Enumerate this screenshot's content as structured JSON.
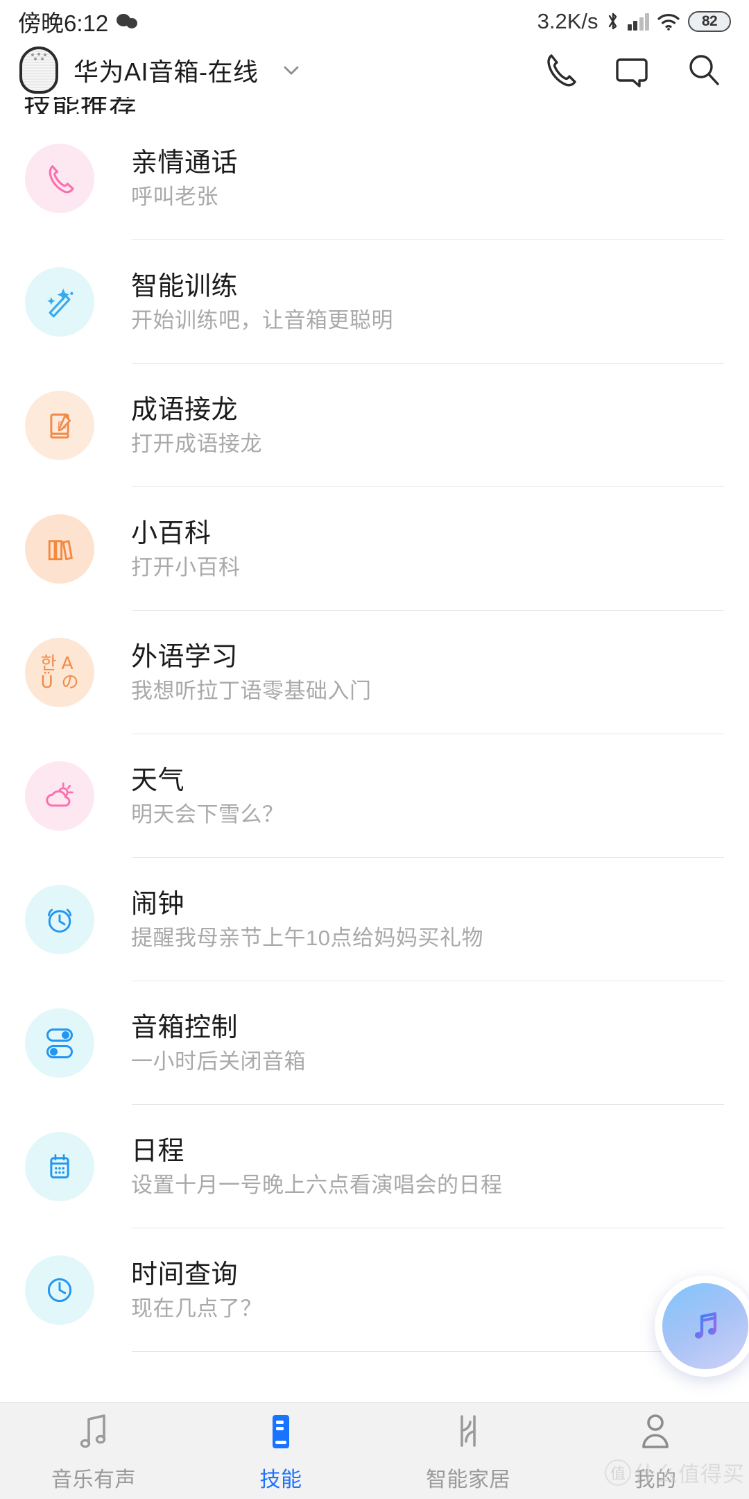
{
  "status_bar": {
    "time": "傍晚6:12",
    "wechat_icon": "wechat-bubbles-icon",
    "network_speed": "3.2K/s",
    "bluetooth_icon": "bluetooth-icon",
    "signal_icon": "cellular-signal-icon",
    "wifi_icon": "wifi-icon",
    "battery_level": "82"
  },
  "header": {
    "device_icon": "smart-speaker-icon",
    "device_name": "华为AI音箱-在线",
    "dropdown_icon": "chevron-down-icon",
    "actions": [
      {
        "name": "call-icon",
        "label": "phone-call"
      },
      {
        "name": "message-icon",
        "label": "chat-message"
      },
      {
        "name": "search-icon",
        "label": "search"
      }
    ]
  },
  "section": {
    "title": "技能推荐"
  },
  "skills": [
    {
      "title": "亲情通话",
      "subtitle": "呼叫老张",
      "icon": "phone-call-icon",
      "bg": "#fde7f1",
      "fg": "#fb6fae"
    },
    {
      "title": "智能训练",
      "subtitle": "开始训练吧，让音箱更聪明",
      "icon": "magic-wand-sparkle-icon",
      "bg": "#e2f7f9",
      "fg": "#36a9f0"
    },
    {
      "title": "成语接龙",
      "subtitle": "打开成语接龙",
      "icon": "idiom-book-pencil-icon",
      "bg": "#fdeadb",
      "fg": "#f08a4b"
    },
    {
      "title": "小百科",
      "subtitle": "打开小百科",
      "icon": "books-icon",
      "bg": "#fde2cf",
      "fg": "#f4883f"
    },
    {
      "title": "外语学习",
      "subtitle": "我想听拉丁语零基础入门",
      "icon": "language-characters-icon",
      "bg": "#fde6d3",
      "fg": "#f08a4b",
      "glyphs": [
        "한",
        "A",
        "Ü",
        "の"
      ]
    },
    {
      "title": "天气",
      "subtitle": "明天会下雪么？",
      "icon": "sun-cloud-weather-icon",
      "bg": "#fde7f1",
      "fg": "#fb6fae"
    },
    {
      "title": "闹钟",
      "subtitle": "提醒我母亲节上午10点给妈妈买礼物",
      "icon": "alarm-clock-icon",
      "bg": "#e2f7f9",
      "fg": "#2196f3"
    },
    {
      "title": "音箱控制",
      "subtitle": "一小时后关闭音箱",
      "icon": "speaker-toggle-control-icon",
      "bg": "#e2f7f9",
      "fg": "#2196f3"
    },
    {
      "title": "日程",
      "subtitle": "设置十月一号晚上六点看演唱会的日程",
      "icon": "calendar-icon",
      "bg": "#e2f7f9",
      "fg": "#2196f3"
    },
    {
      "title": "时间查询",
      "subtitle": "现在几点了？",
      "icon": "clock-icon",
      "bg": "#e2f7f9",
      "fg": "#2196f3"
    }
  ],
  "fab": {
    "icon": "music-note-icon"
  },
  "bottom_nav": {
    "active_index": 1,
    "items": [
      {
        "label": "音乐有声",
        "icon": "music-notes-icon"
      },
      {
        "label": "技能",
        "icon": "speaker-skill-icon"
      },
      {
        "label": "智能家居",
        "icon": "smart-home-icon"
      },
      {
        "label": "我的",
        "icon": "user-profile-icon"
      }
    ]
  },
  "watermark": {
    "badge": "值",
    "text": "什么值得买"
  },
  "colors": {
    "accent_blue": "#1a73ff",
    "pink": "#fb6fae",
    "orange": "#f08a4b",
    "cyan": "#2196f3",
    "nav_bg": "#f2f2f2",
    "text_primary": "#1b1b1b",
    "text_secondary": "#a9a9a9"
  }
}
